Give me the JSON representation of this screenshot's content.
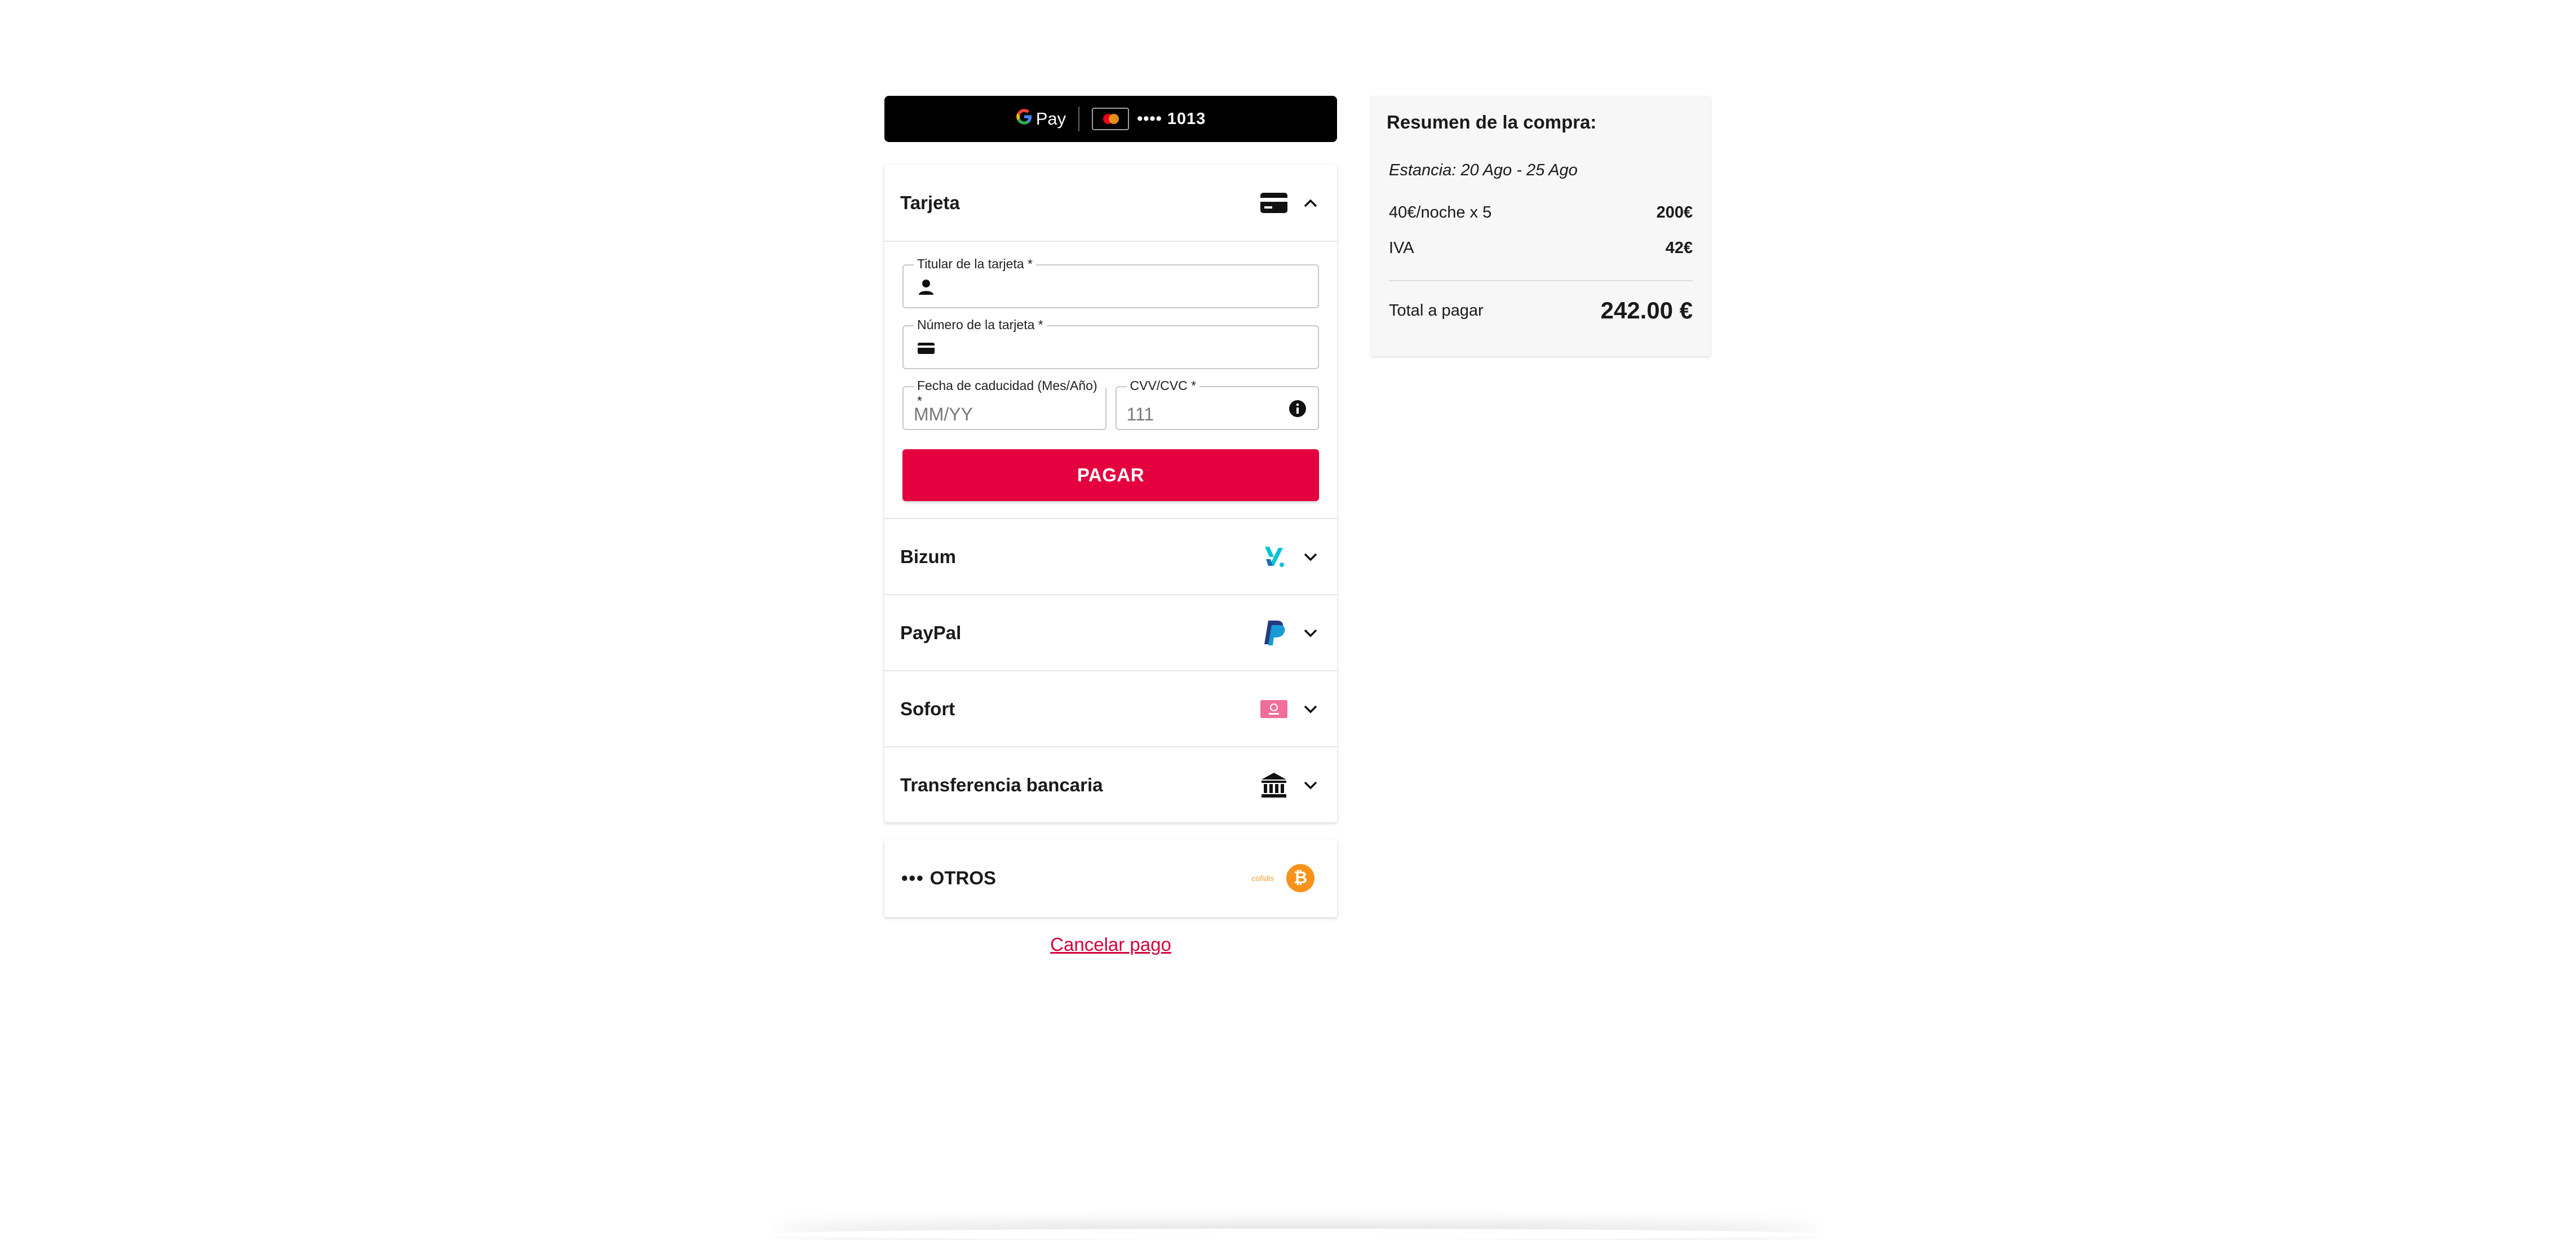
{
  "gpay": {
    "brand": "Pay",
    "card_masked": "•••• 1013"
  },
  "methods": {
    "card": {
      "title": "Tarjeta",
      "holder_label": "Titular de la tarjeta *",
      "number_label": "Número de la tarjeta *",
      "expiry_label": "Fecha de caducidad (Mes/Año) *",
      "expiry_placeholder": "MM/YY",
      "cvv_label": "CVV/CVC *",
      "cvv_placeholder": "111",
      "pay_button": "PAGAR"
    },
    "others": [
      {
        "title": "Bizum",
        "icon": "bizum-icon"
      },
      {
        "title": "PayPal",
        "icon": "paypal-icon"
      },
      {
        "title": "Sofort",
        "icon": "sofort-icon"
      },
      {
        "title": "Transferencia bancaria",
        "icon": "bank-icon"
      }
    ],
    "others_group": {
      "dots": "•••",
      "title": "OTROS",
      "cofidis_label": "cofidis"
    }
  },
  "cancel_link": "Cancelar pago",
  "summary": {
    "title": "Resumen de la compra:",
    "stay": "Estancia: 20 Ago - 25 Ago",
    "lines": [
      {
        "label": "40€/noche x 5",
        "amount": "200€"
      },
      {
        "label": "IVA",
        "amount": "42€"
      }
    ],
    "total_label": "Total a pagar",
    "total_amount": "242.00 €"
  },
  "colors": {
    "accent": "#e4003e",
    "link": "#d6003b"
  }
}
